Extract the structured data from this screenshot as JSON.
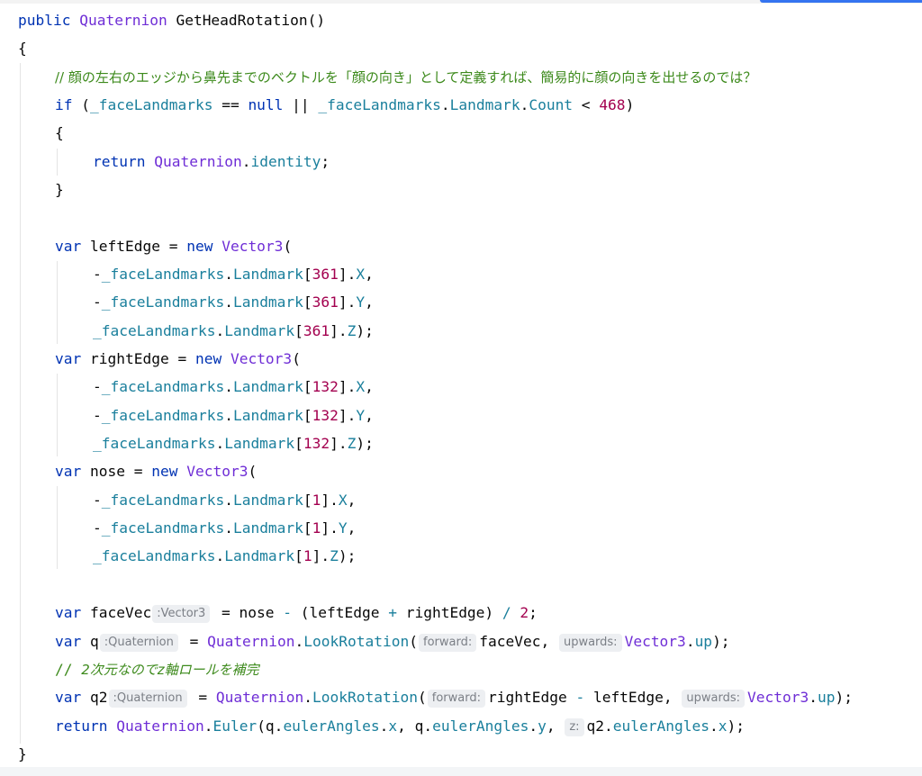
{
  "editor": {
    "colors": {
      "keyword": "#0033b3",
      "type": "#6f2ed6",
      "member": "#1a7f9c",
      "number": "#a3004f",
      "comment": "#3d8a1c",
      "hint_background": "#edeff2",
      "accent": "#3574f0"
    },
    "code": {
      "l1": {
        "kw": "public",
        "type": "Quaternion",
        "method": "GetHeadRotation",
        "rest": "()"
      },
      "l2": {
        "text": "{"
      },
      "l3": {
        "comment": "// 顔の左右のエッジから鼻先までのベクトルを「顔の向き」として定義すれば、簡易的に顔の向きを出せるのでは？"
      },
      "l4": {
        "kw": "if",
        "p1": " (",
        "field": "_faceLandmarks",
        "op": " == ",
        "null": "null",
        "or": " || ",
        "field2": "_faceLandmarks",
        "dot": ".",
        "prop": "Landmark",
        "dot2": ".",
        "prop2": "Count",
        "lt": " < ",
        "num": "468",
        "close": ")"
      },
      "l5": {
        "text": "{"
      },
      "l6": {
        "kw": "return",
        "type": "Quaternion",
        "dot": ".",
        "prop": "identity",
        "end": ";"
      },
      "l7": {
        "text": "}"
      },
      "l9": {
        "kw": "var",
        "name": " leftEdge = ",
        "kw2": "new",
        "type": "Vector3",
        "open": "("
      },
      "l10": {
        "neg": "-",
        "field": "_faceLandmarks",
        "prop": "Landmark",
        "idx": "361",
        "axis": "X",
        "end": ","
      },
      "l11": {
        "neg": "-",
        "field": "_faceLandmarks",
        "prop": "Landmark",
        "idx": "361",
        "axis": "Y",
        "end": ","
      },
      "l12": {
        "neg": "",
        "field": "_faceLandmarks",
        "prop": "Landmark",
        "idx": "361",
        "axis": "Z",
        "end": ");"
      },
      "l13": {
        "kw": "var",
        "name": " rightEdge = ",
        "kw2": "new",
        "type": "Vector3",
        "open": "("
      },
      "l14": {
        "neg": "-",
        "field": "_faceLandmarks",
        "prop": "Landmark",
        "idx": "132",
        "axis": "X",
        "end": ","
      },
      "l15": {
        "neg": "-",
        "field": "_faceLandmarks",
        "prop": "Landmark",
        "idx": "132",
        "axis": "Y",
        "end": ","
      },
      "l16": {
        "neg": "",
        "field": "_faceLandmarks",
        "prop": "Landmark",
        "idx": "132",
        "axis": "Z",
        "end": ");"
      },
      "l17": {
        "kw": "var",
        "name": " nose = ",
        "kw2": "new",
        "type": "Vector3",
        "open": "("
      },
      "l18": {
        "neg": "-",
        "field": "_faceLandmarks",
        "prop": "Landmark",
        "idx": "1",
        "axis": "X",
        "end": ","
      },
      "l19": {
        "neg": "-",
        "field": "_faceLandmarks",
        "prop": "Landmark",
        "idx": "1",
        "axis": "Y",
        "end": ","
      },
      "l20": {
        "neg": "",
        "field": "_faceLandmarks",
        "prop": "Landmark",
        "idx": "1",
        "axis": "Z",
        "end": ");"
      },
      "l22": {
        "kw": "var",
        "name": " faceVec",
        "hint": ":Vector3",
        "rest1": " = nose ",
        "minus": "-",
        "rest2": " (leftEdge ",
        "plus": "+",
        "rest3": " rightEdge) ",
        "div": "/",
        "sp": " ",
        "num": "2",
        "end": ";"
      },
      "l23": {
        "kw": "var",
        "name": " q",
        "hint": ":Quaternion",
        "eq": " = ",
        "type": "Quaternion",
        "dot": ".",
        "method": "LookRotation",
        "open": "(",
        "hint_forward": "forward:",
        "arg1": "faceVec, ",
        "hint_upwards": "upwards:",
        "type2": "Vector3",
        "dot2": ".",
        "prop": "up",
        "end": ");"
      },
      "l24": {
        "comment_prefix": "// ",
        "comment_text": "2次元なのでz軸ロールを補完"
      },
      "l25": {
        "kw": "var",
        "name": " q2",
        "hint": ":Quaternion",
        "eq": " = ",
        "type": "Quaternion",
        "dot": ".",
        "method": "LookRotation",
        "open": "(",
        "hint_forward": "forward:",
        "arg1a": "rightEdge ",
        "minus": "-",
        "arg1b": " leftEdge, ",
        "hint_upwards": "upwards:",
        "type2": "Vector3",
        "dot2": ".",
        "prop": "up",
        "end": ");"
      },
      "l26": {
        "kw": "return",
        "sp": " ",
        "type": "Quaternion",
        "dot": ".",
        "method": "Euler",
        "open": "(q.",
        "p1": "eulerAngles",
        "dot2": ".",
        "x1": "x",
        "mid": ", q.",
        "p2": "eulerAngles",
        "dot3": ".",
        "y1": "y",
        "comma": ", ",
        "hint_z": "z:",
        "arg3": "q2.",
        "p3": "eulerAngles",
        "dot4": ".",
        "x2": "x",
        "end": ");"
      },
      "l27": {
        "text": "}"
      }
    }
  }
}
